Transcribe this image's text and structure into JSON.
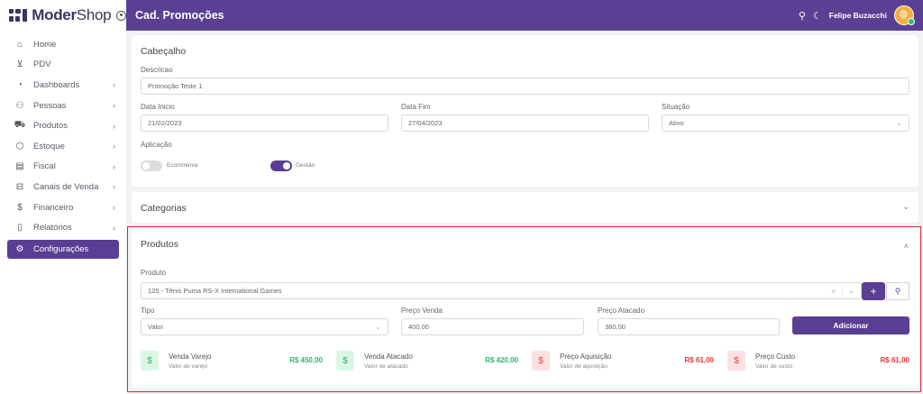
{
  "brand": {
    "name_bold": "Moder",
    "name_rest": "Shop"
  },
  "sidebar": {
    "items": [
      {
        "label": "Home",
        "icon": "home-icon",
        "glyph": "⌂",
        "chevron": false
      },
      {
        "label": "PDV",
        "icon": "cart-icon",
        "glyph": "🛒",
        "chevron": false
      },
      {
        "label": "Dashboards",
        "icon": "pie-chart-icon",
        "glyph": "◔",
        "chevron": true
      },
      {
        "label": "Pessoas",
        "icon": "users-icon",
        "glyph": "👥",
        "chevron": true
      },
      {
        "label": "Produtos",
        "icon": "truck-icon",
        "glyph": "⛟",
        "chevron": true
      },
      {
        "label": "Estoque",
        "icon": "box-icon",
        "glyph": "⬡",
        "chevron": true
      },
      {
        "label": "Fiscal",
        "icon": "document-icon",
        "glyph": "▤",
        "chevron": true
      },
      {
        "label": "Canais de Venda",
        "icon": "store-icon",
        "glyph": "⊟",
        "chevron": true
      },
      {
        "label": "Financeiro",
        "icon": "dollar-icon",
        "glyph": "$",
        "chevron": true
      },
      {
        "label": "Relatórios",
        "icon": "file-icon",
        "glyph": "▯",
        "chevron": true
      },
      {
        "label": "Configurações",
        "icon": "gear-icon",
        "glyph": "⚙",
        "chevron": false,
        "active": true
      }
    ]
  },
  "topbar": {
    "title": "Cad. Promoções",
    "user_name": "Felipe Buzacchi"
  },
  "header_card": {
    "title": "Cabeçalho",
    "descricao_label": "Descricao",
    "descricao_value": "Promoção Teste 1",
    "data_inicio_label": "Data Inicio",
    "data_inicio_value": "21/02/2023",
    "data_fim_label": "Data Fim",
    "data_fim_value": "27/04/2023",
    "situacao_label": "Situação",
    "situacao_value": "Ativo",
    "aplicacao_label": "Aplicação",
    "ecommerce_label": "Ecommerce",
    "gestao_label": "Gestão"
  },
  "categorias_card": {
    "title": "Categorias"
  },
  "produtos_card": {
    "title": "Produtos",
    "produto_label": "Produto",
    "produto_value": "125 - Tênis Puma RS-X International Games",
    "tipo_label": "Tipo",
    "tipo_value": "Valor",
    "preco_venda_label": "Preço Venda",
    "preco_venda_value": "400,00",
    "preco_atacado_label": "Preço Atacado",
    "preco_atacado_value": "380,00",
    "adicionar_label": "Adicionar",
    "stats": [
      {
        "name": "Venda Varejo",
        "sub": "Valor de varejo",
        "value": "R$ 450,00"
      },
      {
        "name": "Venda Atacado",
        "sub": "Valor de atacado",
        "value": "R$ 420,00"
      },
      {
        "name": "Preço Aquisição",
        "sub": "Valor de aquisição",
        "value": "R$ 61,00"
      },
      {
        "name": "Preço Custo",
        "sub": "Valor de custo",
        "value": "R$ 61,00"
      }
    ]
  },
  "colors": {
    "primary": "#5b3f93",
    "green": "#2bb665",
    "red": "#e33333",
    "highlight": "#e02828"
  }
}
